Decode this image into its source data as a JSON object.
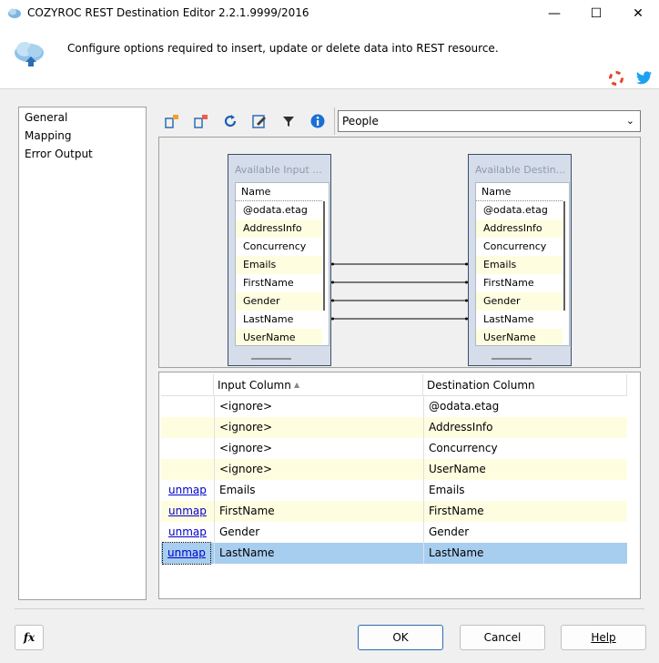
{
  "window": {
    "title": "COZYROC REST Destination Editor 2.2.1.9999/2016",
    "minimize": "—",
    "maximize": "☐",
    "close": "✕"
  },
  "header": {
    "description": "Configure options required to insert, update or delete data into REST resource."
  },
  "nav": {
    "items": [
      "General",
      "Mapping",
      "Error Output"
    ]
  },
  "toolbar": {
    "resource_value": "People"
  },
  "mapping": {
    "input_box": {
      "title": "Available Input ...",
      "header": "Name",
      "rows": [
        "@odata.etag",
        "AddressInfo",
        "Concurrency",
        "Emails",
        "FirstName",
        "Gender",
        "LastName",
        "UserName"
      ]
    },
    "destination_box": {
      "title": "Available Destin...",
      "header": "Name",
      "rows": [
        "@odata.etag",
        "AddressInfo",
        "Concurrency",
        "Emails",
        "FirstName",
        "Gender",
        "LastName",
        "UserName"
      ]
    }
  },
  "grid": {
    "columns": [
      "Input Column",
      "Destination Column"
    ],
    "sort_indicator": "▲",
    "rows": [
      {
        "action": "",
        "input": "<ignore>",
        "destination": "@odata.etag"
      },
      {
        "action": "",
        "input": "<ignore>",
        "destination": "AddressInfo"
      },
      {
        "action": "",
        "input": "<ignore>",
        "destination": "Concurrency"
      },
      {
        "action": "",
        "input": "<ignore>",
        "destination": "UserName"
      },
      {
        "action": "unmap",
        "input": "Emails",
        "destination": "Emails"
      },
      {
        "action": "unmap",
        "input": "FirstName",
        "destination": "FirstName"
      },
      {
        "action": "unmap",
        "input": "Gender",
        "destination": "Gender"
      },
      {
        "action": "unmap",
        "input": "LastName",
        "destination": "LastName"
      }
    ]
  },
  "footer": {
    "fx_label": "fx",
    "ok_label": "OK",
    "cancel_label": "Cancel",
    "help_label": "Help"
  }
}
